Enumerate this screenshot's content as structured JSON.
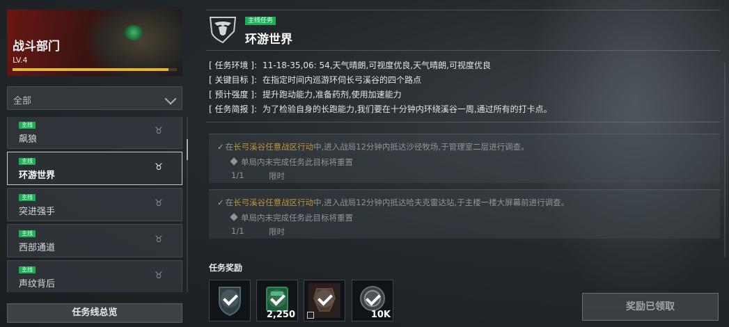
{
  "department": {
    "title": "战斗部门",
    "level": "LV.4",
    "progress": 0.95
  },
  "filter": {
    "selected": "全部"
  },
  "quests": [
    {
      "tag": "主线",
      "name": "飙狼",
      "icon": "rank-badge-icon",
      "selected": false
    },
    {
      "tag": "主线",
      "name": "环游世界",
      "icon": "rank-badge-icon",
      "selected": true
    },
    {
      "tag": "主线",
      "name": "突进强手",
      "icon": "rank-badge-icon",
      "selected": false
    },
    {
      "tag": "主线",
      "name": "西部通道",
      "icon": "rank-badge-icon",
      "selected": false
    },
    {
      "tag": "主线",
      "name": "声纹背后",
      "icon": "rank-badge-icon",
      "selected": false
    }
  ],
  "overview_button": "任务线总览",
  "mission": {
    "tag": "主线任务",
    "title": "环游世界",
    "info": [
      {
        "label": "[ 任务环境 ]:",
        "value": "11-18-35,06: 54,天气晴朗,可视度优良,天气晴朗,可视度优良"
      },
      {
        "label": "[ 关键目标 ]:",
        "value": "在指定时间内巡游环伺长弓溪谷的四个路点"
      },
      {
        "label": "[ 预计强度 ]:",
        "value": "提升跑动能力,准备药剂,使用加速能力"
      },
      {
        "label": "[ 任务简报 ]:",
        "value": "为了检验自身的长跑能力,我们要在十分钟内环绕溪谷一周,通过所有的打卡点。"
      }
    ]
  },
  "objectives": [
    {
      "prefix": "在",
      "highlight": "长弓溪谷任意战区行动",
      "text": "中,进入战局12分钟内抵达沙径牧场,于管理室二层进行调查。",
      "warning": "单局内未完成任务此目标将重置",
      "progress": "1/1",
      "limit": "限时"
    },
    {
      "prefix": "在",
      "highlight": "长弓溪谷任意战区行动",
      "text": "中,进入战局12分钟内抵达哈夫克雷达站,于主楼一楼大屏幕前进行调查。",
      "warning": "单局内未完成任务此目标将重置",
      "progress": "1/1",
      "limit": "限时"
    }
  ],
  "rewards": {
    "label": "任务奖励",
    "items": [
      {
        "icon": "shield-badge-icon",
        "quantity": ""
      },
      {
        "icon": "currency-icon",
        "quantity": "2,250"
      },
      {
        "icon": "ornament-item-icon",
        "quantity": ""
      },
      {
        "icon": "coin-icon",
        "quantity": "10K"
      }
    ]
  },
  "claim_button": "奖励已领取",
  "colors": {
    "tag_green": "#1fae58",
    "highlight_gold": "#b8953a",
    "level_bar": "#e7b43a"
  }
}
